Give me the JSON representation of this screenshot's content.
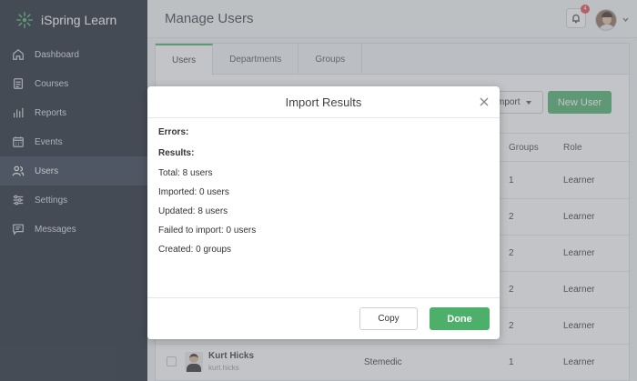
{
  "app": {
    "brand": "iSpring Learn"
  },
  "sidebar": {
    "items": [
      {
        "label": "Dashboard",
        "icon": "home-icon"
      },
      {
        "label": "Courses",
        "icon": "courses-icon"
      },
      {
        "label": "Reports",
        "icon": "reports-icon"
      },
      {
        "label": "Events",
        "icon": "calendar-icon"
      },
      {
        "label": "Users",
        "icon": "users-icon",
        "active": true
      },
      {
        "label": "Settings",
        "icon": "settings-icon"
      },
      {
        "label": "Messages",
        "icon": "messages-icon"
      }
    ]
  },
  "header": {
    "title": "Manage Users",
    "notifications_count": "4"
  },
  "tabs": [
    {
      "label": "Users",
      "active": true
    },
    {
      "label": "Departments"
    },
    {
      "label": "Groups"
    }
  ],
  "toolbar": {
    "import_label": "mport",
    "new_user_label": "New User"
  },
  "table": {
    "columns": {
      "groups": "Groups",
      "role": "Role"
    },
    "rows": [
      {
        "groups": "1",
        "role": "Learner"
      },
      {
        "groups": "2",
        "role": "Learner"
      },
      {
        "groups": "2",
        "role": "Learner"
      },
      {
        "groups": "2",
        "role": "Learner"
      },
      {
        "groups": "2",
        "role": "Learner"
      },
      {
        "name": "Kurt Hicks",
        "login": "kurt.hicks",
        "department": "Stemedic",
        "groups": "1",
        "role": "Learner"
      }
    ]
  },
  "modal": {
    "title": "Import Results",
    "errors_label": "Errors:",
    "results_label": "Results:",
    "total": "Total: 8 users",
    "imported": "Imported: 0 users",
    "updated": "Updated: 8 users",
    "failed": "Failed to import: 0 users",
    "created": "Created: 0 groups",
    "copy_label": "Copy",
    "done_label": "Done"
  },
  "colors": {
    "accent": "#4caf6a",
    "sidebar_bg": "#1d2330",
    "badge": "#e8494f"
  }
}
